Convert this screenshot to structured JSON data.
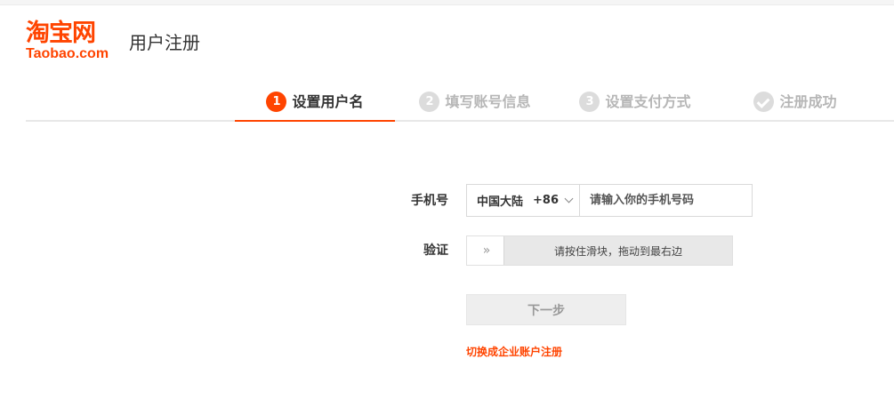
{
  "header": {
    "logo_cn": "淘宝网",
    "logo_en": "Taobao.com",
    "title": "用户注册"
  },
  "steps": [
    {
      "num": "1",
      "label": "设置用户名",
      "active": true
    },
    {
      "num": "2",
      "label": "填写账号信息",
      "active": false
    },
    {
      "num": "3",
      "label": "设置支付方式",
      "active": false
    },
    {
      "icon": "check-icon",
      "label": "注册成功",
      "active": false
    }
  ],
  "form": {
    "phone_label": "手机号",
    "region_name": "中国大陆",
    "region_code": "+86",
    "phone_placeholder": "请输入你的手机号码",
    "verify_label": "验证",
    "slider_handle": "»",
    "slider_hint": "请按住滑块，拖动到最右边",
    "next_label": "下一步",
    "switch_link": "切换成企业账户注册"
  },
  "colors": {
    "accent": "#ff4400",
    "inactive": "#dcdcdc",
    "button_bg": "#eeeeee"
  }
}
